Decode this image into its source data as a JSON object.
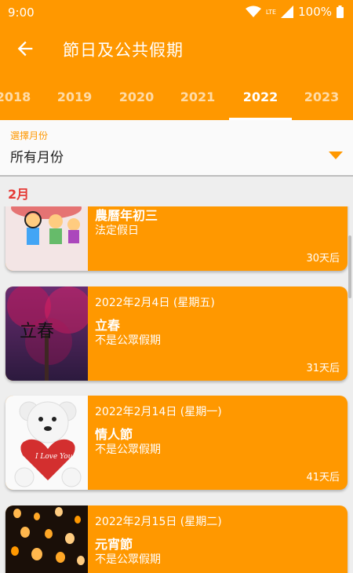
{
  "status_bar": {
    "time": "9:00",
    "battery": "100%",
    "network_label": "LTE"
  },
  "app_bar": {
    "title": "節日及公共假期"
  },
  "tabs": [
    {
      "label": "2018"
    },
    {
      "label": "2019"
    },
    {
      "label": "2020"
    },
    {
      "label": "2021"
    },
    {
      "label": "2022",
      "active": true
    },
    {
      "label": "2023"
    }
  ],
  "filter": {
    "label": "選擇月份",
    "value": "所有月份"
  },
  "month_header": "2月",
  "holidays": [
    {
      "date": "",
      "name": "農曆年初三",
      "type": "法定假日",
      "days_after": "30天后"
    },
    {
      "date": "2022年2月4日 (星期五)",
      "name": "立春",
      "type": "不是公眾假期",
      "days_after": "31天后",
      "image_text": "立春"
    },
    {
      "date": "2022年2月14日 (星期一)",
      "name": "情人節",
      "type": "不是公眾假期",
      "days_after": "41天后",
      "image_text": "I Love You"
    },
    {
      "date": "2022年2月15日 (星期二)",
      "name": "元宵節",
      "type": "不是公眾假期",
      "days_after": ""
    }
  ],
  "colors": {
    "primary": "#ff9800",
    "accent_red": "#e53935"
  }
}
